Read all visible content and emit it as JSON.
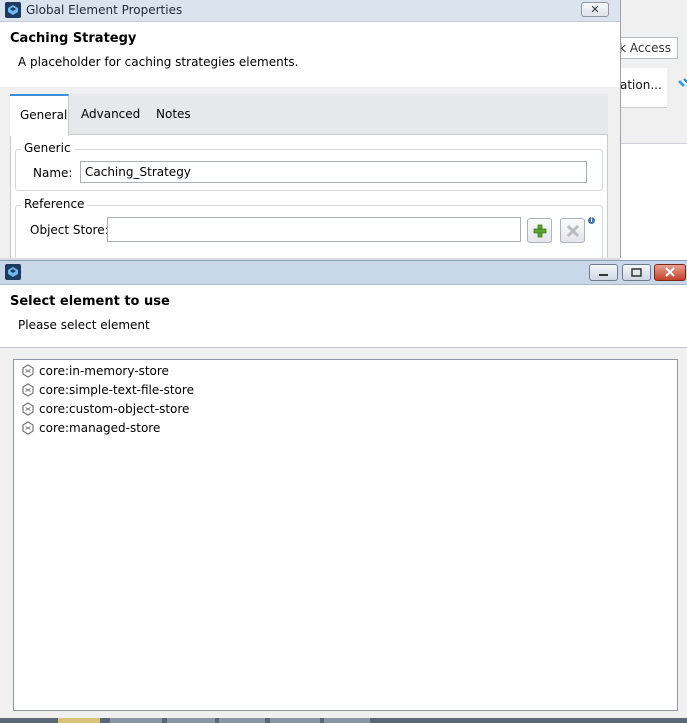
{
  "background_ide": {
    "quick_access_text": "k Access",
    "tab_text": "ation..."
  },
  "window1": {
    "title": "Global Element Properties",
    "close_symbol": "✕",
    "header": {
      "title": "Caching Strategy",
      "description": "A placeholder for caching strategies elements."
    },
    "tabs": [
      {
        "label": "General",
        "active": true
      },
      {
        "label": "Advanced",
        "active": false
      },
      {
        "label": "Notes",
        "active": false
      }
    ],
    "generic_group": {
      "label": "Generic",
      "name_label": "Name:",
      "name_value": "Caching_Strategy"
    },
    "reference_group": {
      "label": "Reference",
      "object_store_label": "Object Store:",
      "object_store_value": ""
    },
    "icons": {
      "add": "plus-icon",
      "remove": "x-icon",
      "info": "info-icon"
    }
  },
  "window2": {
    "header": {
      "title": "Select element to use",
      "description": "Please select element"
    },
    "list_items": [
      {
        "label": "core:in-memory-store",
        "icon": "element-icon"
      },
      {
        "label": "core:simple-text-file-store",
        "icon": "element-icon"
      },
      {
        "label": "core:custom-object-store",
        "icon": "element-icon"
      },
      {
        "label": "core:managed-store",
        "icon": "element-icon"
      }
    ],
    "controls": [
      "minimize",
      "maximize",
      "close"
    ]
  },
  "colors": {
    "accent_tab": "#3a8fd6",
    "app_icon": "#1d3b5e",
    "add_icon": "#5aa52e",
    "close_button": "#c0422a"
  }
}
